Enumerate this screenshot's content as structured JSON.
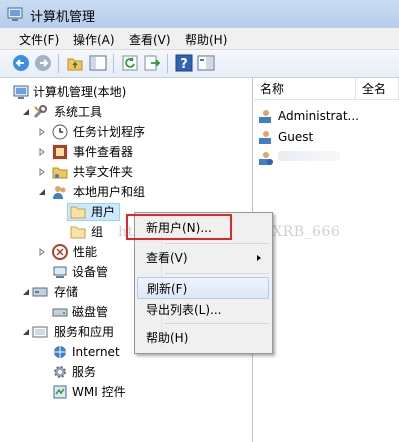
{
  "window": {
    "title": "计算机管理"
  },
  "menu": [
    "文件(F)",
    "操作(A)",
    "查看(V)",
    "帮助(H)"
  ],
  "toolbar_icons": [
    "back-icon",
    "forward-icon",
    "up-folder-icon",
    "show-tree-icon",
    "refresh-icon",
    "export-icon",
    "help-icon",
    "properties-icon"
  ],
  "tree": {
    "root": "计算机管理(本地)",
    "system_tools": "系统工具",
    "task_scheduler": "任务计划程序",
    "event_viewer": "事件查看器",
    "shared_folders": "共享文件夹",
    "local_users_groups": "本地用户和组",
    "users": "用户",
    "groups": "组",
    "performance": "性能",
    "device_manager": "设备管",
    "storage": "存储",
    "disk_management": "磁盘管",
    "services_apps": "服务和应用",
    "internet_info": "Internet",
    "services": "服务",
    "wmi": "WMI 控件"
  },
  "list": {
    "columns": [
      "名称",
      "全名"
    ],
    "rows": [
      "Administrat...",
      "Guest"
    ]
  },
  "context_menu": {
    "new_user": "新用户(N)...",
    "view": "查看(V)",
    "refresh": "刷新(F)",
    "export_list": "导出列表(L)...",
    "help": "帮助(H)"
  },
  "watermark": "http://blog.csdn.net/XRB_666",
  "colors": {
    "highlight": "#e0262b",
    "selection": "#cce8ff",
    "titlebar": "#b4cdeb"
  }
}
